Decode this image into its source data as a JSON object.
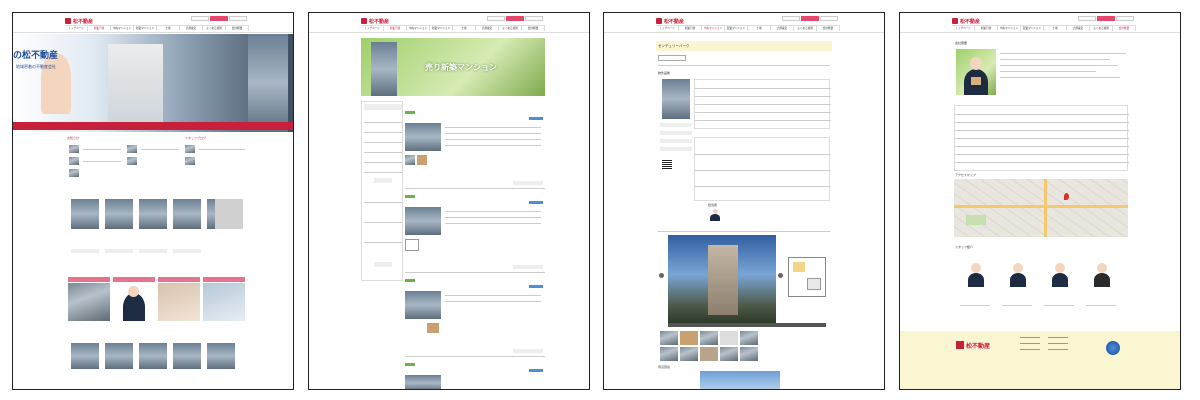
{
  "site": {
    "logo_text": "松不動産",
    "nav": [
      "トップページ",
      "新築戸建",
      "中古マンション",
      "新築マンション",
      "土地",
      "売却査定",
      "よくある質問",
      "会社概要",
      "お問合せ"
    ]
  },
  "panel1": {
    "hero_title": "の松不動産",
    "hero_sub": "地域密着の不動産会社",
    "section_info": "お知らせ",
    "section_blog": "スタッフブログ"
  },
  "panel2": {
    "banner_title": "売り新築マンション",
    "listing_labels": [
      "新着",
      "新着",
      "新着",
      "新着"
    ],
    "price_label": "価格"
  },
  "panel3": {
    "detail_title": "センチュリーパーク",
    "section_photos": "物件画像",
    "section_staff": "担当者",
    "section_map": "周辺環境"
  },
  "panel4": {
    "company_title": "会社概要",
    "access_title": "アクセスマップ",
    "staff_title": "スタッフ紹介",
    "footer_logo": "松不動産"
  },
  "colors": {
    "brand_red": "#c7203d",
    "accent_pink": "#e8738d",
    "footer_yellow": "#fbf6d2"
  }
}
